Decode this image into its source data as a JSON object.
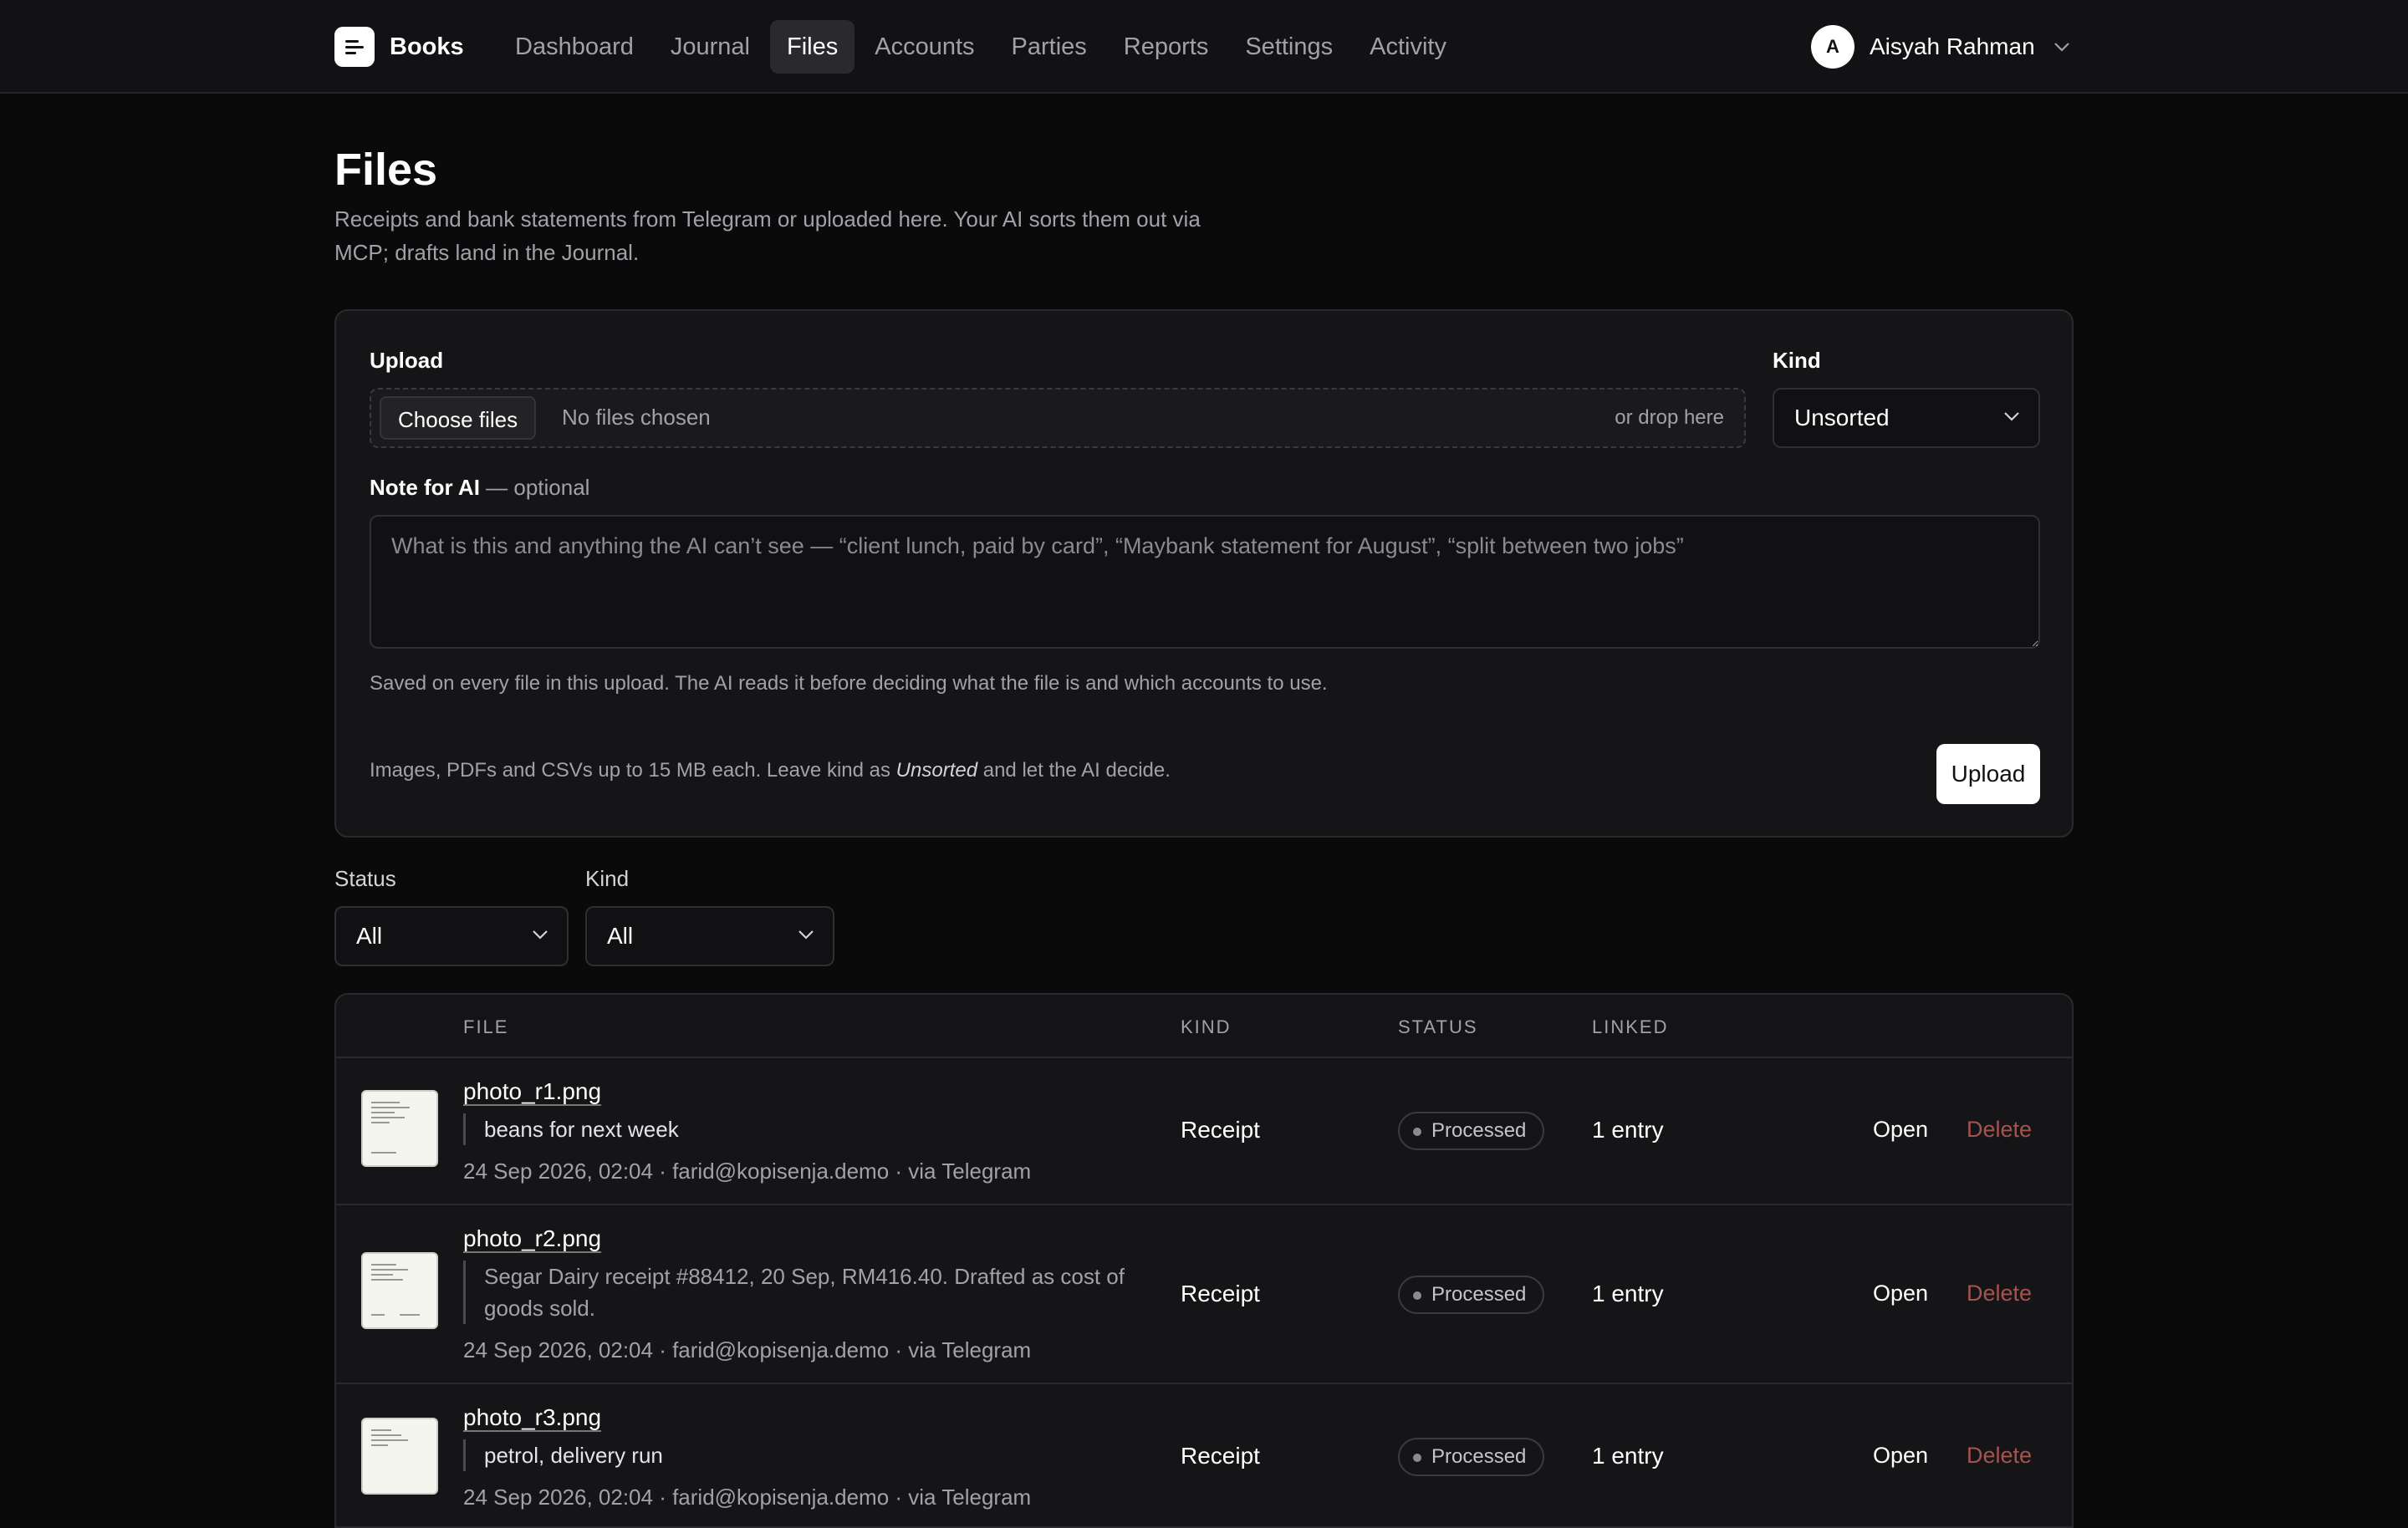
{
  "app": {
    "name": "Books",
    "logo_icon": "notebook-lines-icon"
  },
  "nav": [
    {
      "label": "Dashboard",
      "active": false
    },
    {
      "label": "Journal",
      "active": false
    },
    {
      "label": "Files",
      "active": true
    },
    {
      "label": "Accounts",
      "active": false
    },
    {
      "label": "Parties",
      "active": false
    },
    {
      "label": "Reports",
      "active": false
    },
    {
      "label": "Settings",
      "active": false
    },
    {
      "label": "Activity",
      "active": false
    }
  ],
  "user": {
    "initial": "A",
    "name": "Aisyah Rahman"
  },
  "page": {
    "title": "Files",
    "subtitle": "Receipts and bank statements from Telegram or uploaded here. Your AI sorts them out via MCP; drafts land in the Journal."
  },
  "upload": {
    "label": "Upload",
    "choose_label": "Choose files",
    "no_files": "No files chosen",
    "drop_hint": "or drop here",
    "kind_label": "Kind",
    "kind_value": "Unsorted",
    "note_label": "Note for AI",
    "note_optional": " — optional",
    "note_placeholder": "What is this and anything the AI can’t see — “client lunch, paid by card”, “Maybank statement for August”, “split between two jobs”",
    "note_help": "Saved on every file in this upload. The AI reads it before deciding what the file is and which accounts to use.",
    "limits_pre": "Images, PDFs and CSVs up to 15 MB each. Leave kind as ",
    "limits_em": "Unsorted",
    "limits_post": " and let the AI decide.",
    "button": "Upload"
  },
  "filters": {
    "status_label": "Status",
    "status_value": "All",
    "kind_label": "Kind",
    "kind_value": "All"
  },
  "table": {
    "columns": {
      "file": "FILE",
      "kind": "KIND",
      "status": "STATUS",
      "linked": "LINKED"
    },
    "open_label": "Open",
    "delete_label": "Delete",
    "rows": [
      {
        "name": "photo_r1.png",
        "note": "beans for next week",
        "meta": "24 Sep 2026, 02:04 · farid@kopisenja.demo · via Telegram",
        "kind": "Receipt",
        "status": "Processed",
        "linked": "1 entry"
      },
      {
        "name": "photo_r2.png",
        "note": "Segar Dairy receipt #88412, 20 Sep, RM416.40. Drafted as cost of goods sold.",
        "meta": "24 Sep 2026, 02:04 · farid@kopisenja.demo · via Telegram",
        "kind": "Receipt",
        "status": "Processed",
        "linked": "1 entry"
      },
      {
        "name": "photo_r3.png",
        "note": "petrol, delivery run",
        "meta": "24 Sep 2026, 02:04 · farid@kopisenja.demo · via Telegram",
        "kind": "Receipt",
        "status": "Processed",
        "linked": "1 entry"
      }
    ]
  },
  "colors": {
    "background": "#0a0a0b",
    "card": "#151517",
    "delete": "#a5534f",
    "accent_button": "#ffffff"
  }
}
